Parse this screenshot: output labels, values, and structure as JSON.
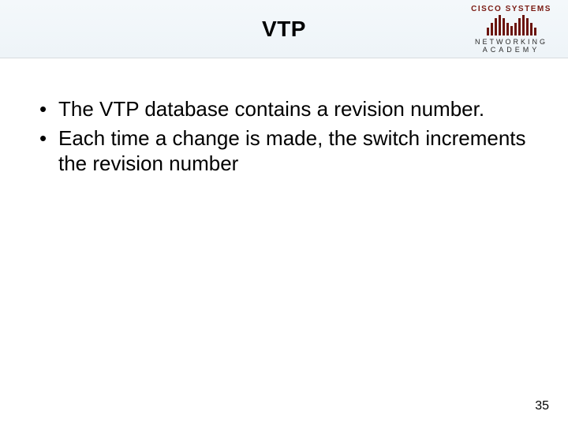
{
  "header": {
    "title": "VTP",
    "logo": {
      "brand": "CISCO SYSTEMS",
      "line1": "NETWORKING",
      "line2": "ACADEMY"
    }
  },
  "bullets": [
    "The VTP database contains a revision number.",
    "Each time a change is made, the switch increments the revision number"
  ],
  "page_number": "35"
}
